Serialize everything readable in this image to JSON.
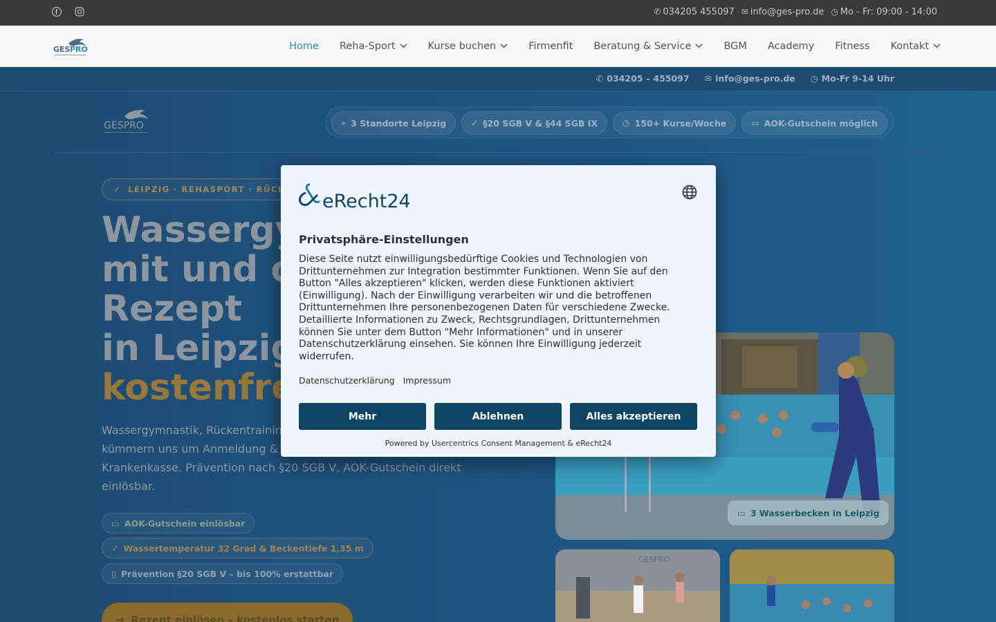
{
  "topbar": {
    "phone": "034205 455097",
    "email": "info@ges-pro.de",
    "hours": "Mo - Fr: 09:00 - 14:00"
  },
  "nav": {
    "items": [
      {
        "label": "Home",
        "dropdown": false,
        "active": true
      },
      {
        "label": "Reha-Sport",
        "dropdown": true,
        "active": false
      },
      {
        "label": "Kurse buchen",
        "dropdown": true,
        "active": false
      },
      {
        "label": "Firmenfit",
        "dropdown": false,
        "active": false
      },
      {
        "label": "Beratung & Service",
        "dropdown": true,
        "active": false
      },
      {
        "label": "BGM",
        "dropdown": false,
        "active": false
      },
      {
        "label": "Academy",
        "dropdown": false,
        "active": false
      },
      {
        "label": "Fitness",
        "dropdown": false,
        "active": false
      },
      {
        "label": "Kontakt",
        "dropdown": true,
        "active": false
      }
    ],
    "active_color": "#2c8fb8"
  },
  "subbar": {
    "phone": "034205 – 455097",
    "email": "info@ges-pro.de",
    "hours": "Mo-Fr 9-14 Uhr"
  },
  "pills": [
    "3 Standorte Leipzig",
    "§20 SGB V & §44 SGB IX",
    "150+ Kurse/Woche",
    "AOK-Gutschein möglich"
  ],
  "hero": {
    "tagline": "LEIPZIG · REHASPORT · RÜCKEN",
    "headline_lines": [
      "Wassergy",
      "mit und o",
      "Rezept",
      "in Leipzig"
    ],
    "headline_gold": "kostenfre",
    "lead": "Wassergymnastik, Rückentraining … kümmern uns um Anmeldung & … Krankenkasse. Prävention nach §20 SGB V, AOK-Gutschein direkt einlösbar.",
    "lead_lines": [
      "Wassergymnastik, Rückentrainin",
      "kümmern uns um Anmeldung &",
      "Krankenkasse. Prävention nach §20 SGB V, AOK-Gutschein direkt",
      "einlösbar."
    ],
    "chips": [
      "AOK-Gutschein einlösbar",
      "Wassertemperatur 32 Grad & Beckentiefe 1,35 m",
      "Prävention §20 SGB V – bis 100% erstattbar"
    ],
    "cta": "Rezept einlösen – kostenlos starten",
    "photo_badge": "3 Wasserbecken in Leipzig",
    "gold_color": "#d4a64a"
  },
  "modal": {
    "brand": "eRecht24",
    "title": "Privatsphäre-Einstellungen",
    "body": "Diese Seite nutzt einwilligungsbedürftige Cookies und Technologien von Drittunternehmen zur Integration bestimmter Funktionen. Wenn Sie auf den Button \"Alles akzeptieren\" klicken, werden diese Funktionen aktiviert (Einwilligung). Nach der Einwilligung verarbeiten wir und die betroffenen Drittunternehmen Ihre personenbezogenen Daten für verschiedene Zwecke. Detaillierte Informationen zu Zweck, Rechtsgrundlagen, Drittunternehmen können Sie unter dem Button \"Mehr Informationen\" und in unserer Datenschutzerklärung einsehen. Sie können Ihre Einwilligung jederzeit widerrufen.",
    "link_privacy": "Datenschutzerklärung",
    "link_imprint": "Impressum",
    "btn_more": "Mehr",
    "btn_decline": "Ablehnen",
    "btn_accept": "Alles akzeptieren",
    "powered": "Powered by Usercentrics Consent Management & eRecht24",
    "button_color": "#0f4562"
  }
}
